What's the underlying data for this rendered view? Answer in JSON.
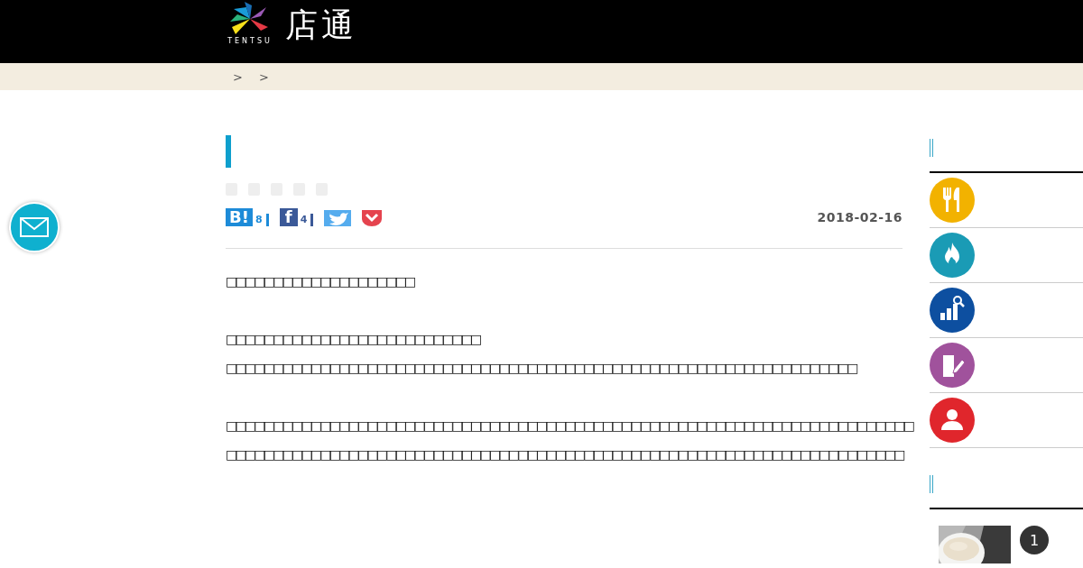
{
  "header": {
    "logo_caption": "TENTSU",
    "logo_title": "店通"
  },
  "breadcrumb": [
    ">",
    ">"
  ],
  "article": {
    "tags": [
      {
        "kind": "tag"
      },
      {
        "kind": "tag"
      },
      {
        "kind": "tag"
      },
      {
        "kind": "tag"
      },
      {
        "kind": "tag"
      }
    ],
    "share": [
      {
        "kind": "hatena",
        "label": "B!",
        "count": "8"
      },
      {
        "kind": "facebook",
        "label": "f",
        "count": "4"
      },
      {
        "kind": "twitter"
      },
      {
        "kind": "pocket"
      }
    ],
    "date": "2018-02-16",
    "paragraphs": [
      {
        "lines": [
          "□□□□□□□□□□□□□□□□□□□□"
        ]
      },
      {
        "lines": [
          "□□□□□□□□□□□**□□**□□□□□□□□□□□□□□",
          "□□□□□□□□□□□□□□□□□□□□□□□□□□□□□□□□□□□□□□□□□□□□□□□□□□□□□□□□□□□□□□□□□□□"
        ]
      },
      {
        "lines": [
          "□□□□□□□□□□□□□□□□□□□□□□□□□□□□□□□□□□□□□□□□□□□□□□□□□□□□□□□□□□□□□□□□□□□□□□□□□",
          "□□□□□□□□□□□□□□□□□□□□□□□□□□□□□□□□□□□□□□□□□□□□□□□□□□□□□□□□□□□□□□□□□□□□□□□□"
        ]
      }
    ]
  },
  "sidebar": {
    "sections": [
      {
        "kind": "menu",
        "items": [
          {
            "color": "#f2b200"
          },
          {
            "color": "#1a9bb5"
          },
          {
            "color": "#0d4fa0"
          },
          {
            "color": "#a0529c"
          },
          {
            "color": "#e0262c"
          }
        ]
      },
      {
        "kind": "ranking",
        "items": [
          {
            "rank": "1"
          }
        ]
      }
    ]
  }
}
